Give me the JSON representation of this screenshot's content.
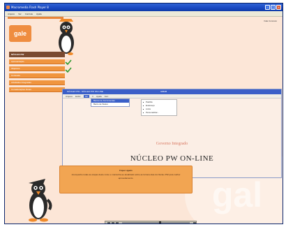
{
  "window": {
    "title": "Macromedia Flash Player 8"
  },
  "menubar": [
    "Arquivo",
    "Ver",
    "Controle",
    "Ajuda"
  ],
  "top_right_link": "Fale Conosco",
  "logo_text": "gale",
  "sidebar": {
    "title": "NÚCLEO PW",
    "items": [
      "Apresentação",
      "Objetivos",
      "Conteúdo",
      "Atividades Integradas",
      "Considerações Finais"
    ],
    "completed_items": [
      0,
      1
    ]
  },
  "inner_window": {
    "title": "NÚCLEO PW - NÚCLEO PW ON-LINE",
    "title_mid": "GIBAB",
    "menu": [
      "Arquivo",
      "Exibir",
      "Ver",
      "Ir",
      "Ajuda",
      "Ferr."
    ],
    "selected_menu_index": 2,
    "dropdown": [
      "Barras de Ferramentas",
      "Barra de Status"
    ],
    "submenu": [
      "Padrão",
      "Endereço",
      "Links",
      "Personalizar..."
    ],
    "heading": "Governo Integrado",
    "main_title": "NÚCLEO PW ON-LINE"
  },
  "tip": {
    "title": "Fique Ligado",
    "text": "Acompanhe todas as etapas deste curso e mantenha-se atualizado sobre as ferramentas do Núcleo PW para melhor aproveitamento."
  },
  "watermark_text": "gal",
  "player": {
    "progress": 0.55
  },
  "colors": {
    "orange": "#f0953f",
    "brown": "#7a4a30",
    "blue": "#3a5fc8",
    "background": "#fce6d7"
  }
}
